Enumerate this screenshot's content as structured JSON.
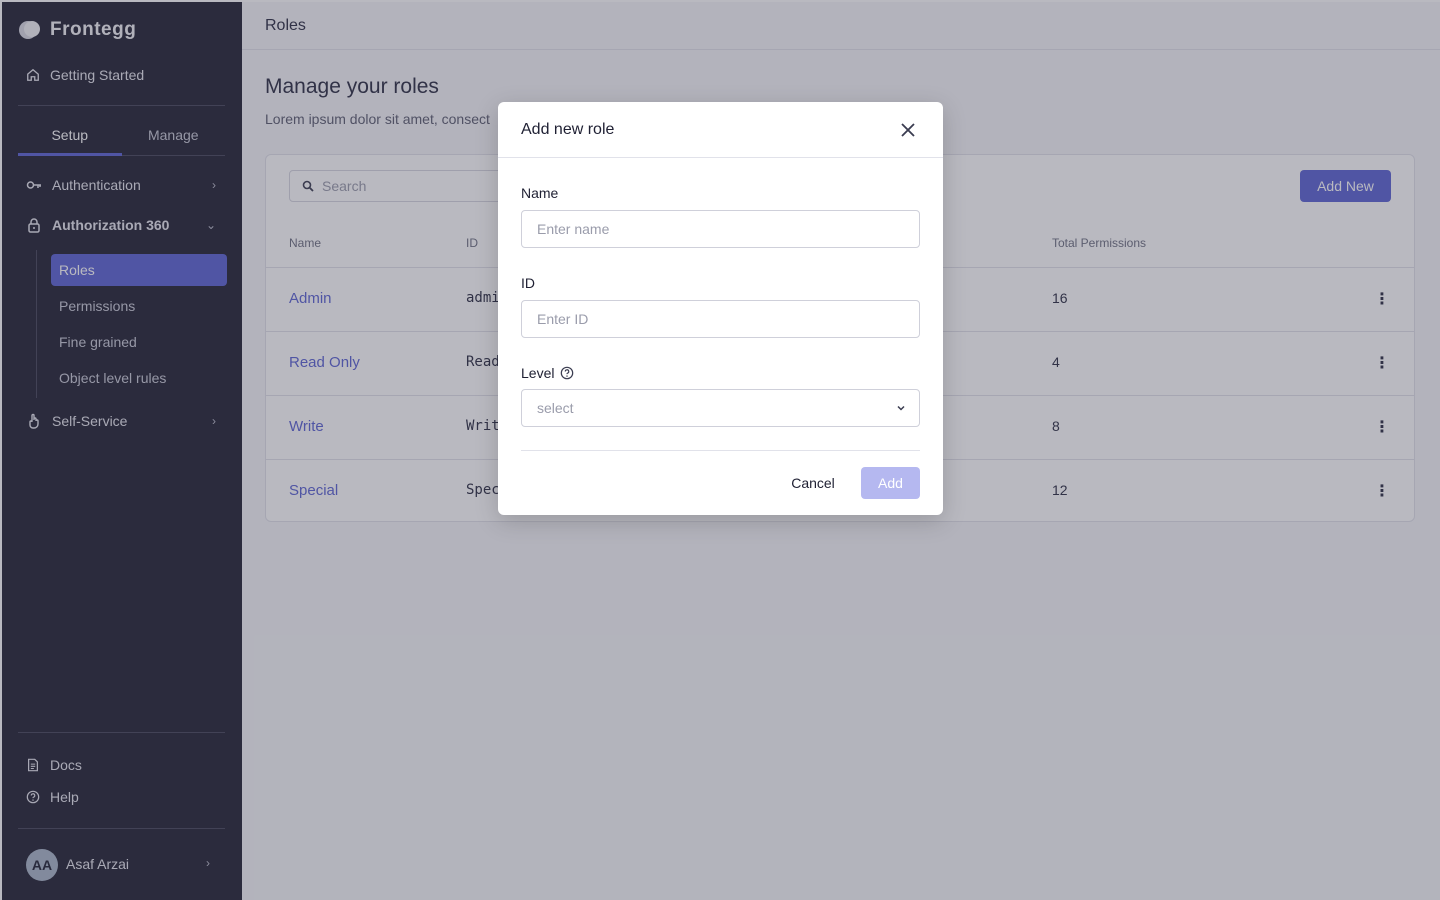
{
  "sidebar": {
    "brand": "Frontegg",
    "getting_started": "Getting Started",
    "tabs": [
      "Setup",
      "Manage"
    ],
    "nav": {
      "authentication": "Authentication",
      "authorization": "Authorization 360",
      "self_service": "Self-Service"
    },
    "sub_items": [
      "Roles",
      "Permissions",
      "Fine grained",
      "Object level rules"
    ],
    "docs": "Docs",
    "help": "Help",
    "user": {
      "initials": "AA",
      "name": "Asaf Arzai"
    }
  },
  "header": {
    "title": "Roles"
  },
  "page": {
    "heading": "Manage your roles",
    "description": "Lorem ipsum dolor sit amet, consect"
  },
  "table": {
    "search_placeholder": "Search",
    "add_new_label": "Add New",
    "columns": {
      "name": "Name",
      "id": "ID",
      "total_permissions": "Total Permissions"
    },
    "rows": [
      {
        "name": "Admin",
        "id": "admi",
        "total_permissions": "16"
      },
      {
        "name": "Read Only",
        "id": "Read",
        "total_permissions": "4"
      },
      {
        "name": "Write",
        "id": "Writ",
        "total_permissions": "8"
      },
      {
        "name": "Special",
        "id": "Spec",
        "total_permissions": "12"
      }
    ]
  },
  "modal": {
    "title": "Add new role",
    "name_label": "Name",
    "name_placeholder": "Enter name",
    "id_label": "ID",
    "id_placeholder": "Enter ID",
    "level_label": "Level",
    "level_placeholder": "select",
    "cancel_label": "Cancel",
    "add_label": "Add"
  },
  "colors": {
    "sidebar_bg": "#212232",
    "accent": "#5b63d3",
    "add_disabled": "#b5b8f0",
    "link": "#5b63d3"
  },
  "icons": {
    "brand": "frontegg-logo-icon",
    "getting_started": "home-icon",
    "authentication": "key-icon",
    "authorization": "lock-icon",
    "self_service": "hand-pointer-icon",
    "docs": "document-icon",
    "help": "help-circle-icon",
    "search": "search-icon",
    "close": "close-icon",
    "level_help": "help-circle-icon",
    "select_chevron": "chevron-down-icon",
    "row_menu": "more-vertical-icon"
  }
}
